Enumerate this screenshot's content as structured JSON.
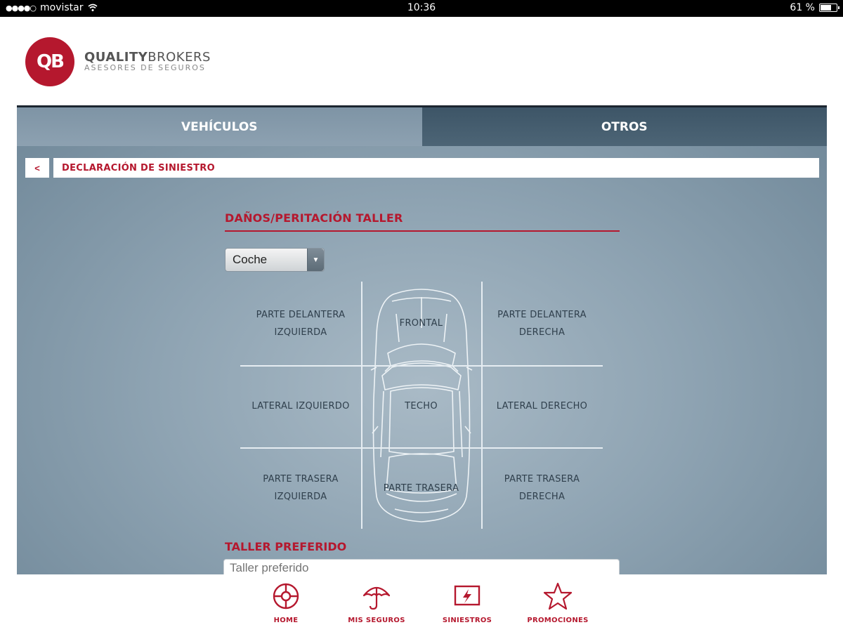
{
  "statusbar": {
    "carrier": "movistar",
    "time": "10:36",
    "battery": "61 %",
    "battery_level": 0.61
  },
  "header": {
    "logo_mark": "QB",
    "brand_bold": "QUALITY",
    "brand_light": "BROKERS",
    "brand_sub": "ASESORES DE SEGUROS"
  },
  "tabs": [
    {
      "label": "VEHÍCULOS",
      "active": true
    },
    {
      "label": "OTROS",
      "active": false
    }
  ],
  "breadcrumb": {
    "back": "<",
    "title": "DECLARACIÓN DE SINIESTRO"
  },
  "damage": {
    "title": "DAÑOS/PERITACIÓN TALLER",
    "vehicle_select": "Coche",
    "zones": {
      "front_left": [
        "PARTE DELANTERA",
        "IZQUIERDA"
      ],
      "front": "FRONTAL",
      "front_right": [
        "PARTE DELANTERA",
        "DERECHA"
      ],
      "side_left": "LATERAL IZQUIERDO",
      "roof": "TECHO",
      "side_right": "LATERAL DERECHO",
      "rear_left": [
        "PARTE TRASERA",
        "IZQUIERDA"
      ],
      "rear": "PARTE TRASERA",
      "rear_right": [
        "PARTE TRASERA",
        "DERECHA"
      ]
    }
  },
  "workshop": {
    "title": "TALLER PREFERIDO",
    "placeholder": "Taller preferido"
  },
  "bottom_nav": [
    {
      "label": "HOME",
      "icon": "crosshair-icon"
    },
    {
      "label": "MIS SEGUROS",
      "icon": "umbrella-icon"
    },
    {
      "label": "SINIESTROS",
      "icon": "lightning-screen-icon"
    },
    {
      "label": "PROMOCIONES",
      "icon": "star-icon"
    }
  ],
  "colors": {
    "brand": "#b5182e",
    "panel": "#8fa4b3",
    "tab_inactive": "#3d5567"
  }
}
